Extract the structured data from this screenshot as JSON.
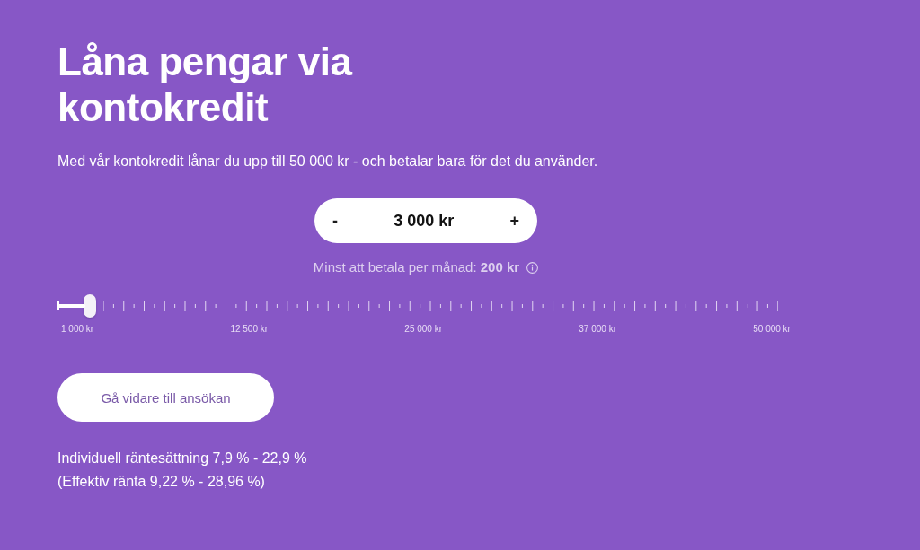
{
  "heading": "Låna pengar via kontokredit",
  "intro": "Med vår kontokredit lånar du upp till 50 000 kr - och betalar bara för det du använder.",
  "amount_stepper": {
    "decrease": "-",
    "value": "3 000 kr",
    "increase": "+"
  },
  "minimum_payment": "Minst att betala per månad: **200 kr**",
  "slider": {
    "level": 0.04,
    "tick_labels": [
      "1 000 kr",
      "12 500 kr",
      "25 000 kr",
      "37 000 kr",
      "50 000 kr"
    ]
  },
  "apply_button": "Gå vidare till ansökan",
  "interest_lines": [
    "Individuell räntesättning 7,9 % - 22,9 %",
    "(Effektiv ränta 9,22 % - 28,96 %)"
  ]
}
